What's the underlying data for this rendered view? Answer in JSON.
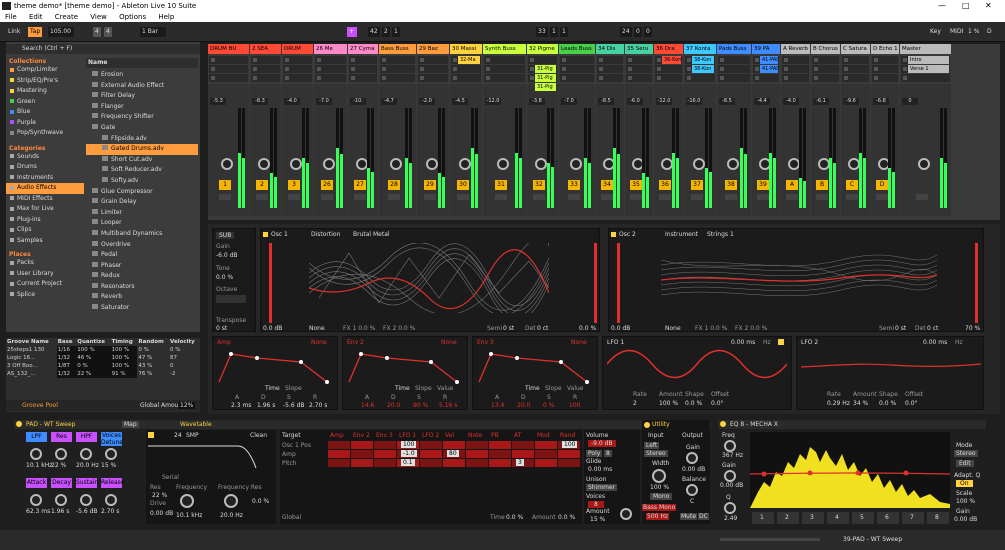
{
  "window": {
    "title": "theme demo*  [theme demo] - Ableton Live 10 Suite",
    "min": "—",
    "max": "□",
    "close": "✕"
  },
  "menu": [
    "File",
    "Edit",
    "Create",
    "View",
    "Options",
    "Help"
  ],
  "transport": {
    "link": "Link",
    "tap": "Tap",
    "tempo": "105.00",
    "sig1": "4",
    "sig2": "4",
    "quant": "1 Bar",
    "pos1": "42",
    "pos2": "2",
    "pos3": "1",
    "pos4": "33",
    "pos5": "1",
    "pos6": "1",
    "pos7": "24",
    "pos8": "0",
    "pos9": "0",
    "key": "Key",
    "midi": "MIDI",
    "pct": "1 %",
    "d": "D"
  },
  "browser": {
    "search": "Search (Ctrl + F)",
    "collections_h": "Collections",
    "collections": [
      {
        "label": "Comp/Limiter",
        "color": "#ff9c3e"
      },
      {
        "label": "Strip/EQ/Pre's",
        "color": "#ffd23e"
      },
      {
        "label": "Mastering",
        "color": "#ffd23e"
      },
      {
        "label": "Green",
        "color": "#48d148"
      },
      {
        "label": "Blue",
        "color": "#3e8cff"
      },
      {
        "label": "Purple",
        "color": "#b04eff"
      },
      {
        "label": "Pop/Synthwave",
        "color": "#888888"
      }
    ],
    "categories_h": "Categories",
    "categories": [
      "Sounds",
      "Drums",
      "Instruments",
      "Audio Effects",
      "MIDI Effects",
      "Max for Live",
      "Plug-ins",
      "Clips",
      "Samples"
    ],
    "places_h": "Places",
    "places": [
      "Packs",
      "User Library",
      "Current Project",
      "Splice"
    ],
    "name_h": "Name",
    "items": [
      "Erosion",
      "External Audio Effect",
      "Filter Delay",
      "Flanger",
      "Frequency Shifter",
      "Gate",
      "Flipside.adv",
      "Gated Drums.adv",
      "Short Cut.adv",
      "Soft Reducer.adv",
      "Softy.adv",
      "Glue Compressor",
      "Grain Delay",
      "Limiter",
      "Looper",
      "Multiband Dynamics",
      "Overdrive",
      "Pedal",
      "Phaser",
      "Redux",
      "Resonators",
      "Reverb",
      "Saturator"
    ]
  },
  "groove": {
    "headers": [
      "Groove Name",
      "Base",
      "Quantize",
      "Timing",
      "Random",
      "Velocity"
    ],
    "rows": [
      [
        "25steps1 130",
        "1/16",
        "100 %",
        "100 %",
        "0 %",
        "0 %"
      ],
      [
        "Logic 16...",
        "1/32",
        "46 %",
        "100 %",
        "47 %",
        "87"
      ],
      [
        "3 Off Boo...",
        "1/8T",
        "0 %",
        "100 %",
        "43 %",
        "0"
      ],
      [
        "AS_132_...",
        "1/32",
        "22 %",
        "91 %",
        "76 %",
        "-2"
      ]
    ],
    "pool": "Groove Pool",
    "global": "Global Amount",
    "global_val": "12%"
  },
  "mixer": {
    "tracks": [
      {
        "name": "DRUM BU",
        "color": "#ff4a36",
        "num": "1",
        "vol": "-5.3"
      },
      {
        "name": "2 SEA",
        "color": "#ff4a36",
        "num": "2",
        "vol": "-8.3"
      },
      {
        "name": "DRUM",
        "color": "#ff4a36",
        "num": "3",
        "vol": "-4.0"
      },
      {
        "name": "26 Me",
        "color": "#ff89c9",
        "num": "26",
        "vol": "-7.0"
      },
      {
        "name": "27 Cyma",
        "color": "#ff89c9",
        "num": "27",
        "vol": "-10."
      },
      {
        "name": "Bass Buss",
        "color": "#ff9c3e",
        "num": "28",
        "vol": "-4.7"
      },
      {
        "name": "29 Baz",
        "color": "#ff9c3e",
        "num": "29",
        "vol": "-2.0"
      },
      {
        "name": "30 Massi",
        "color": "#ffd23e",
        "num": "30",
        "vol": "-4.5"
      },
      {
        "name": "Synth Buss",
        "color": "#c8ff3e",
        "num": "31",
        "vol": "-12.0"
      },
      {
        "name": "32 Pigme",
        "color": "#c8ff3e",
        "num": "32",
        "vol": "-3.8"
      },
      {
        "name": "Leads Buss",
        "color": "#48d148",
        "num": "33",
        "vol": "-7.0"
      },
      {
        "name": "34 Dis",
        "color": "#48d1a0",
        "num": "34",
        "vol": "-8.5"
      },
      {
        "name": "35 Seru",
        "color": "#48d1a0",
        "num": "35",
        "vol": "-6.0"
      },
      {
        "name": "36 Dra",
        "color": "#ff4a36",
        "num": "36",
        "vol": "-12.0"
      },
      {
        "name": "37 Konta",
        "color": "#3ec8ff",
        "num": "37",
        "vol": "-16.0"
      },
      {
        "name": "Pads Buss",
        "color": "#3e8cff",
        "num": "38",
        "vol": "-8.5"
      },
      {
        "name": "39 PA",
        "color": "#3e8cff",
        "num": "39",
        "vol": "-4.4"
      },
      {
        "name": "A Reverb",
        "color": "#bbbbbb",
        "num": "A",
        "vol": "-4.0"
      },
      {
        "name": "B Chorus",
        "color": "#bbbbbb",
        "num": "B",
        "vol": "-6.1"
      },
      {
        "name": "C Satura",
        "color": "#bbbbbb",
        "num": "C",
        "vol": "-9.6"
      },
      {
        "name": "D Echo 1",
        "color": "#bbbbbb",
        "num": "D",
        "vol": "-6.8"
      },
      {
        "name": "Master",
        "color": "#bbbbbb",
        "num": "",
        "vol": "0"
      }
    ],
    "clips": [
      "32-Ma",
      "31-Pig",
      "31-Pig",
      "31-Pig",
      "36-Kon",
      "38-Kon",
      "38-Kon",
      "41-PAD",
      "41-PAD",
      "Intro",
      "Verse 1"
    ]
  },
  "synth": {
    "sub": "SUB",
    "gain_l": "Gain",
    "gain": "-6.0 dB",
    "tone_l": "Tone",
    "tone": "0.0 %",
    "oct_l": "Octave",
    "transpose_l": "Transpose",
    "transpose": "0 st",
    "osc1": "Osc 1",
    "osc1_fx": "Distortion",
    "osc1_preset": "Brutal Metal",
    "osc1_gain": "0.0 dB",
    "osc1_none": "None",
    "osc1_fx1": "FX 1 0.0 %",
    "osc1_fx2": "FX 2 0.0 %",
    "osc1_semi": "Semi",
    "osc1_semi_v": "0 st",
    "osc1_det": "Det",
    "osc1_det_v": "0 ct",
    "osc1_pct": "0.0 %",
    "osc2": "Osc 2",
    "osc2_fx": "Instrument",
    "osc2_preset": "Strings 1",
    "osc2_gain": "0.0 dB",
    "osc2_none": "None",
    "osc2_fx1": "FX 1 0.0 %",
    "osc2_fx2": "FX 2 0.0 %",
    "osc2_semi": "Semi",
    "osc2_semi_v": "0 st",
    "osc2_det": "Det",
    "osc2_det_v": "0 ct",
    "osc2_pct": "70 %",
    "envs": [
      {
        "name": "Amp",
        "none": "None",
        "a": "2.3 ms",
        "d": "1.96 s",
        "s": "-5.6 dB",
        "r": "2.70 s"
      },
      {
        "name": "Env 2",
        "none": "None",
        "a": "14.6",
        "d": "20.0",
        "s": "90 %",
        "r": "5.16 s"
      },
      {
        "name": "Env 3",
        "none": "None",
        "a": "13.4",
        "d": "20.0",
        "s": "0 %",
        "r": "100"
      }
    ],
    "time": "Time",
    "slope": "Slope",
    "value": "Value",
    "lfo1": "LFO 1",
    "lfo1_rate": "0.00 ms",
    "lfo1_hz": "Hz",
    "lfo2": "LFO 2",
    "lfo2_rate": "0.00 ms",
    "lfo2_hz": "Hz",
    "lfo_labels": [
      "Rate",
      "Amount",
      "Shape",
      "Offset"
    ],
    "lfo1_vals": [
      "2",
      "100 %",
      "0.0 %",
      "0.0°"
    ],
    "lfo2_vals": [
      "0.29 Hz",
      "34 %",
      "0.0 %",
      "0.0°"
    ]
  },
  "wavetable": {
    "title": "PAD - WT Sweep",
    "map": "Map",
    "buttons": [
      [
        "LPF",
        "10.1 kHz"
      ],
      [
        "Res",
        "22 %"
      ],
      [
        "HPF",
        "20.0 Hz"
      ],
      [
        "Voices Detune",
        "15 %"
      ],
      [
        "Attack",
        "62.3 ms"
      ],
      [
        "Decay",
        "1.96 s"
      ],
      [
        "Sustain",
        "-5.6 dB"
      ],
      [
        "Release",
        "2.70 s"
      ]
    ],
    "devname": "Wavetable",
    "smp": "24",
    "smp_l": "SMP",
    "clean": "Clean",
    "serial": "Serial",
    "res": "Res",
    "res_v": "22 %",
    "drive": "Drive",
    "drive_v": "0.00 dB",
    "freq": "Frequency",
    "freq_v": "10.1 kHz",
    "freqres": "Frequency Res",
    "freqres_v": "20.0 Hz",
    "pct": "0.0 %",
    "matrix_target": "Target",
    "matrix_cols": [
      "Amp",
      "Env 2",
      "Env 3",
      "LFO 1",
      "LFO 2",
      "Vel",
      "Note",
      "PB",
      "AT",
      "Mod",
      "Rand"
    ],
    "matrix_rows": [
      "Osc 1 Pos",
      "Amp",
      "Pitch"
    ],
    "mat_vals": [
      "100",
      "-1.0",
      "0.1",
      "80",
      "3",
      "100"
    ],
    "global": "Global",
    "time": "Time",
    "time_v": "0.0 %",
    "amount": "Amount",
    "amount_v": "0.0 %",
    "volume": "Volume",
    "volume_v": "-9.0 dB",
    "poly": "Poly",
    "poly_v": "8",
    "glide": "Glide",
    "glide_v": "0.00 ms",
    "unison": "Unison",
    "unison_v": "Shimmer",
    "voices": "Voices",
    "voices_v": "8",
    "amount2": "Amount",
    "amount2_v": "15 %"
  },
  "utility": {
    "title": "Utility",
    "input": "Input",
    "output": "Output",
    "left": "Left",
    "stereo": "Stereo",
    "width": "Width",
    "width_v": "100 %",
    "mono": "Mono",
    "bassmono": "Bass Mono",
    "bass_v": "500 Hz",
    "gain": "Gain",
    "gain_v": "0.00 dB",
    "balance": "Balance",
    "balance_v": "C",
    "mute": "Mute",
    "dc": "DC"
  },
  "eq8": {
    "title": "EQ 8 - MECHA X",
    "freq": "Freq",
    "freq_v": "367 Hz",
    "gain": "Gain",
    "gain_v": "0.00 dB",
    "q": "Q",
    "q_v": "2.49",
    "mode": "Mode",
    "mode_v": "Stereo",
    "edit": "Edit",
    "adapt": "Adapt. Q",
    "on": "On",
    "scale": "Scale",
    "scale_v": "100 %",
    "gain2": "Gain",
    "gain2_v": "0.00 dB",
    "bands": [
      "1",
      "2",
      "3",
      "4",
      "5",
      "6",
      "7",
      "8"
    ]
  },
  "status": {
    "track": "39-PAD - WT Sweep"
  }
}
